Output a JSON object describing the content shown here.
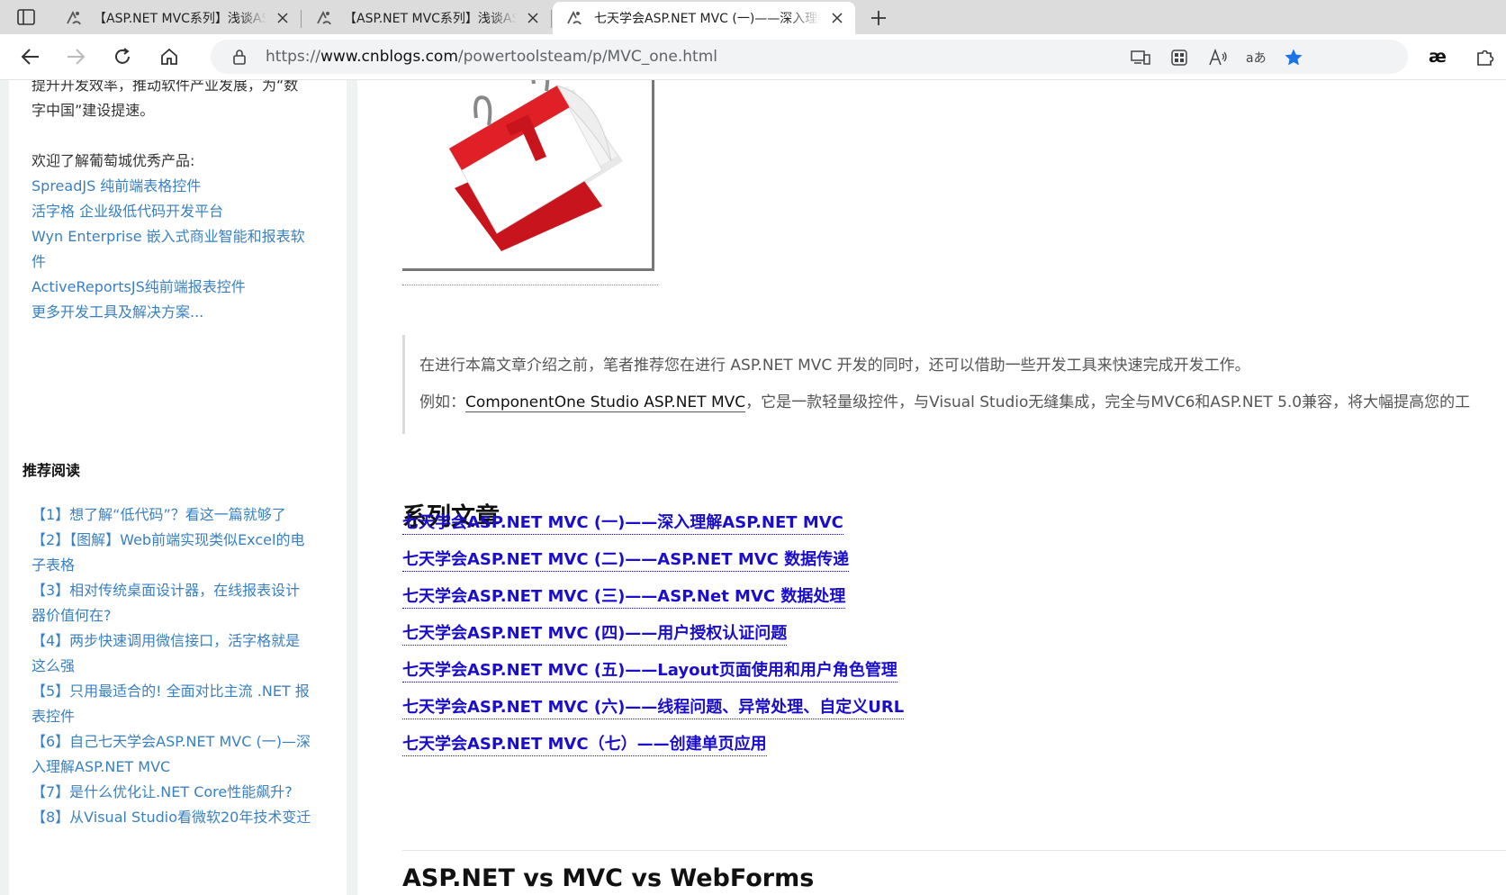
{
  "browser": {
    "tabs": [
      {
        "title": "【ASP.NET MVC系列】浅谈ASP.NET"
      },
      {
        "title": "【ASP.NET MVC系列】浅谈ASP.NET"
      },
      {
        "title": "七天学会ASP.NET MVC (一)——深入理解ASP.NET MVC"
      }
    ],
    "url_prefix": "https://",
    "url_host": "www.cnblogs.com",
    "url_path": "/powertoolsteam/p/MVC_one.html",
    "accent_color": "#1a73e8"
  },
  "sidebar": {
    "intro_line1": "提升开发效率，推动软件产业发展，为“数",
    "intro_line2": "字中国”建设提速。",
    "welcome": "欢迎了解葡萄城优秀产品:",
    "products": [
      {
        "label": "SpreadJS 纯前端表格控件"
      },
      {
        "label": "活字格 企业级低代码开发平台"
      },
      {
        "label": "Wyn Enterprise 嵌入式商业智能和报表软"
      },
      {
        "label": "件"
      },
      {
        "label": "ActiveReportsJS纯前端报表控件"
      },
      {
        "label": "更多开发工具及解决方案..."
      }
    ],
    "recommend_title": "推荐阅读",
    "recommend_lines": [
      "【1】想了解“低代码”？看这一篇就够了",
      "【2】【图解】Web前端实现类似Excel的电",
      "子表格",
      "【3】相对传统桌面设计器，在线报表设计",
      "器价值何在?",
      "【4】两步快速调用微信接口，活字格就是",
      "这么强",
      "【5】只用最适合的! 全面对比主流 .NET 报",
      "表控件",
      "【6】自己七天学会ASP.NET MVC (一)—深",
      "入理解ASP.NET MVC",
      "【7】是什么优化让.NET Core性能飙升?",
      "【8】从Visual Studio看微软20年技术变迁"
    ]
  },
  "content": {
    "calendar_image": "calendar-icon",
    "quote_line1": "在进行本篇文章介绍之前，笔者推荐您在进行 ASP.NET MVC 开发的同时，还可以借助一些开发工具来快速完成开发工作。",
    "quote_line2_prefix": "例如：",
    "quote_line2_link": "ComponentOne Studio ASP.NET MVC",
    "quote_line2_suffix": "，它是一款轻量级控件，与Visual Studio无缝集成，完全与MVC6和ASP.NET 5.0兼容，将大幅提高您的工",
    "series_heading": "系列文章",
    "series_links": [
      "七天学会ASP.NET MVC (一)——深入理解ASP.NET MVC",
      "七天学会ASP.NET MVC (二)——ASP.NET MVC 数据传递",
      "七天学会ASP.NET MVC (三)——ASP.Net MVC 数据处理",
      "七天学会ASP.NET MVC (四)——用户授权认证问题",
      "七天学会ASP.NET MVC (五)——Layout页面使用和用户角色管理",
      " 七天学会ASP.NET MVC (六)——线程问题、异常处理、自定义URL",
      "七天学会ASP.NET MVC（七）——创建单页应用"
    ],
    "next_heading": "ASP.NET vs MVC vs WebForms",
    "link_color": "#1a0dcc"
  }
}
